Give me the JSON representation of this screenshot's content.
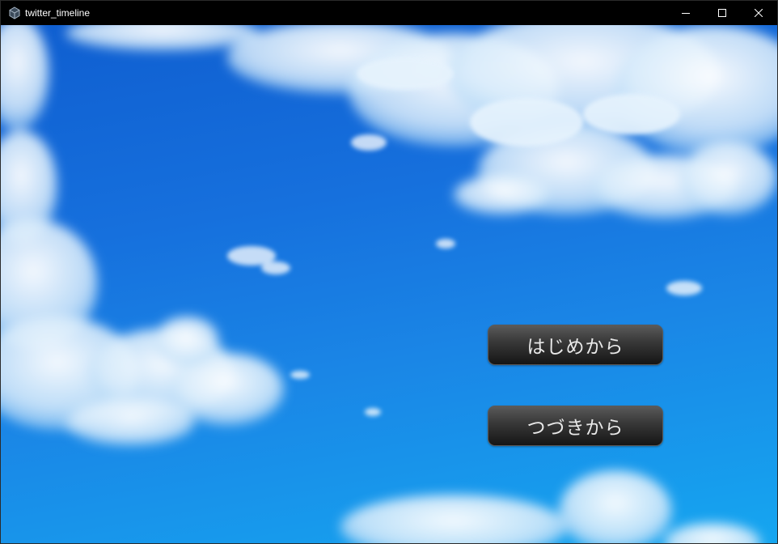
{
  "window": {
    "title": "twitter_timeline",
    "controls": {
      "minimize_icon": "minimize-icon",
      "maximize_icon": "maximize-icon",
      "close_icon": "close-icon"
    }
  },
  "title_menu": {
    "new_game_label": "はじめから",
    "continue_label": "つづきから"
  },
  "colors": {
    "sky_top": "#0f5ed0",
    "sky_bottom": "#15a6f0",
    "button_top": "#5a5a5a",
    "button_bottom": "#151515",
    "button_text": "#e9e9e9"
  }
}
